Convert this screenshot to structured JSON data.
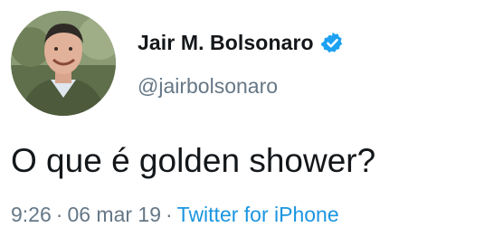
{
  "author": {
    "display_name": "Jair M. Bolsonaro",
    "handle": "@jairbolsonaro",
    "verified": true,
    "verified_icon": "verified-badge-icon"
  },
  "tweet": {
    "text": "O que é golden shower?",
    "time": "9:26",
    "separator": "·",
    "date": "06 mar 19",
    "source": "Twitter for iPhone"
  },
  "colors": {
    "name": "#14171a",
    "secondary": "#657786",
    "link": "#1b95e0",
    "verified": "#1da1f2"
  }
}
